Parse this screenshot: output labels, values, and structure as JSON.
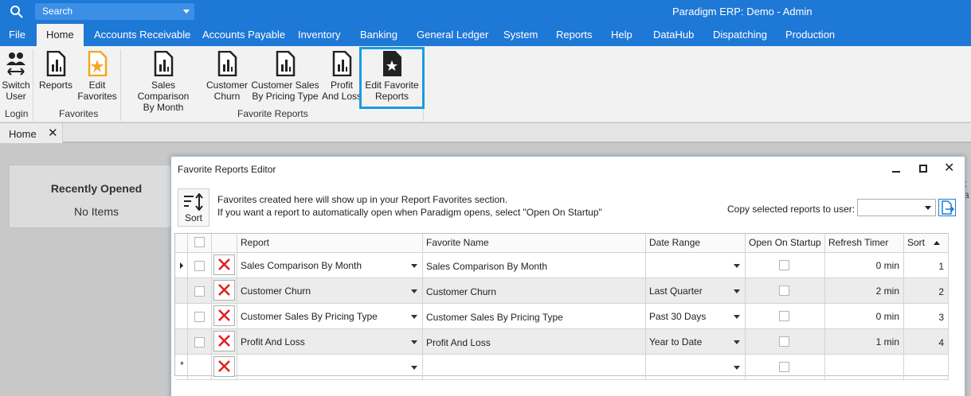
{
  "titlebar": {
    "search_placeholder": "Search",
    "app_title": "Paradigm ERP: Demo - Admin"
  },
  "menu": {
    "file": "File",
    "home": "Home",
    "accounts_receivable": "Accounts Receivable",
    "accounts_payable": "Accounts Payable",
    "inventory": "Inventory",
    "banking": "Banking",
    "general_ledger": "General Ledger",
    "system": "System",
    "reports": "Reports",
    "help": "Help",
    "datahub": "DataHub",
    "dispatching": "Dispatching",
    "production": "Production"
  },
  "ribbon": {
    "switch_user_1": "Switch",
    "switch_user_2": "User",
    "login_group": "Login",
    "reports": "Reports",
    "edit_fav_1": "Edit",
    "edit_fav_2": "Favorites",
    "favorites_group": "Favorites",
    "sales_comp_1": "Sales Comparison",
    "sales_comp_2": "By Month",
    "churn_1": "Customer",
    "churn_2": "Churn",
    "pricing_1": "Customer Sales",
    "pricing_2": "By Pricing Type",
    "pl_1": "Profit",
    "pl_2": "And Loss",
    "edit_fav_reports_1": "Edit Favorite",
    "edit_fav_reports_2": "Reports",
    "favorite_reports_group": "Favorite Reports"
  },
  "doc_tabs": {
    "home": "Home",
    "close": "✕"
  },
  "recent": {
    "heading": "Recently Opened",
    "text": "No Items"
  },
  "right_edge": {
    "line1": "t",
    "line2": "a"
  },
  "dialog": {
    "title": "Favorite Reports Editor",
    "sort_label": "Sort",
    "info_line1": "Favorites created here will show up in your Report Favorites section.",
    "info_line2": "If you want a report to automatically open when Paradigm opens, select \"Open On Startup\"",
    "copy_label": "Copy selected reports to user:",
    "columns": {
      "report": "Report",
      "favorite_name": "Favorite Name",
      "date_range": "Date Range",
      "open_on_startup": "Open On Startup",
      "refresh_timer": "Refresh Timer",
      "sort": "Sort"
    },
    "rows": [
      {
        "report": "Sales Comparison By Month",
        "favorite_name": "Sales Comparison By Month",
        "date_range": "",
        "refresh": "0 min",
        "sort": "1"
      },
      {
        "report": "Customer Churn",
        "favorite_name": "Customer Churn",
        "date_range": "Last Quarter",
        "refresh": "2 min",
        "sort": "2"
      },
      {
        "report": "Customer Sales By Pricing Type",
        "favorite_name": "Customer Sales By Pricing Type",
        "date_range": "Past 30 Days",
        "refresh": "0 min",
        "sort": "3"
      },
      {
        "report": "Profit And Loss",
        "favorite_name": "Profit And Loss",
        "date_range": "Year to Date",
        "refresh": "1 min",
        "sort": "4"
      }
    ],
    "new_row_marker": "*"
  },
  "colors": {
    "accent": "#1e78d6",
    "highlight": "#1a9be0",
    "delete_red": "#e0201c"
  }
}
